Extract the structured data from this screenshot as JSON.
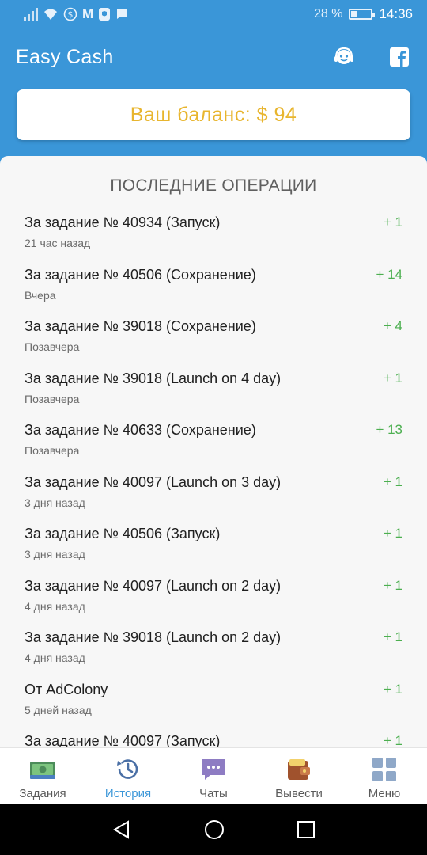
{
  "status_bar": {
    "battery_pct": "28 %",
    "time": "14:36",
    "battery_level": 0.28,
    "mail_icon_text": "M"
  },
  "app_bar": {
    "title": "Easy Cash",
    "icons": [
      "support-icon",
      "facebook-icon"
    ]
  },
  "balance": {
    "text": "Ваш баланс: $ 94"
  },
  "operations": {
    "title": "ПОСЛЕДНИЕ ОПЕРАЦИИ",
    "items": [
      {
        "title": "За задание № 40934  (Запуск)",
        "subtitle": "21 час назад",
        "amount": "+ 1"
      },
      {
        "title": "За задание № 40506  (Сохранение)",
        "subtitle": "Вчера",
        "amount": "+ 14"
      },
      {
        "title": "За задание № 39018  (Сохранение)",
        "subtitle": "Позавчера",
        "amount": "+ 4"
      },
      {
        "title": "За задание № 39018  (Launch on 4 day)",
        "subtitle": "Позавчера",
        "amount": "+ 1"
      },
      {
        "title": "За задание № 40633  (Сохранение)",
        "subtitle": "Позавчера",
        "amount": "+ 13"
      },
      {
        "title": "За задание № 40097  (Launch on 3 day)",
        "subtitle": "3 дня назад",
        "amount": "+ 1"
      },
      {
        "title": "За задание № 40506  (Запуск)",
        "subtitle": "3 дня назад",
        "amount": "+ 1"
      },
      {
        "title": "За задание № 40097  (Launch on 2 day)",
        "subtitle": "4 дня назад",
        "amount": "+ 1"
      },
      {
        "title": "За задание № 39018  (Launch on 2 day)",
        "subtitle": "4 дня назад",
        "amount": "+ 1"
      },
      {
        "title": "От AdColony",
        "subtitle": "5 дней назад",
        "amount": "+ 1"
      },
      {
        "title": "За задание № 40097  (Запуск)",
        "subtitle": "",
        "amount": "+ 1"
      }
    ]
  },
  "bottom_nav": [
    {
      "label": "Задания",
      "icon": "money-icon",
      "active": false
    },
    {
      "label": "История",
      "icon": "history-icon",
      "active": true
    },
    {
      "label": "Чаты",
      "icon": "chat-icon",
      "active": false
    },
    {
      "label": "Вывести",
      "icon": "wallet-icon",
      "active": false
    },
    {
      "label": "Меню",
      "icon": "grid-menu-icon",
      "active": false
    }
  ],
  "colors": {
    "primary": "#3a96d8",
    "balance_text": "#e8b52e",
    "positive_amount": "#4caf50"
  }
}
